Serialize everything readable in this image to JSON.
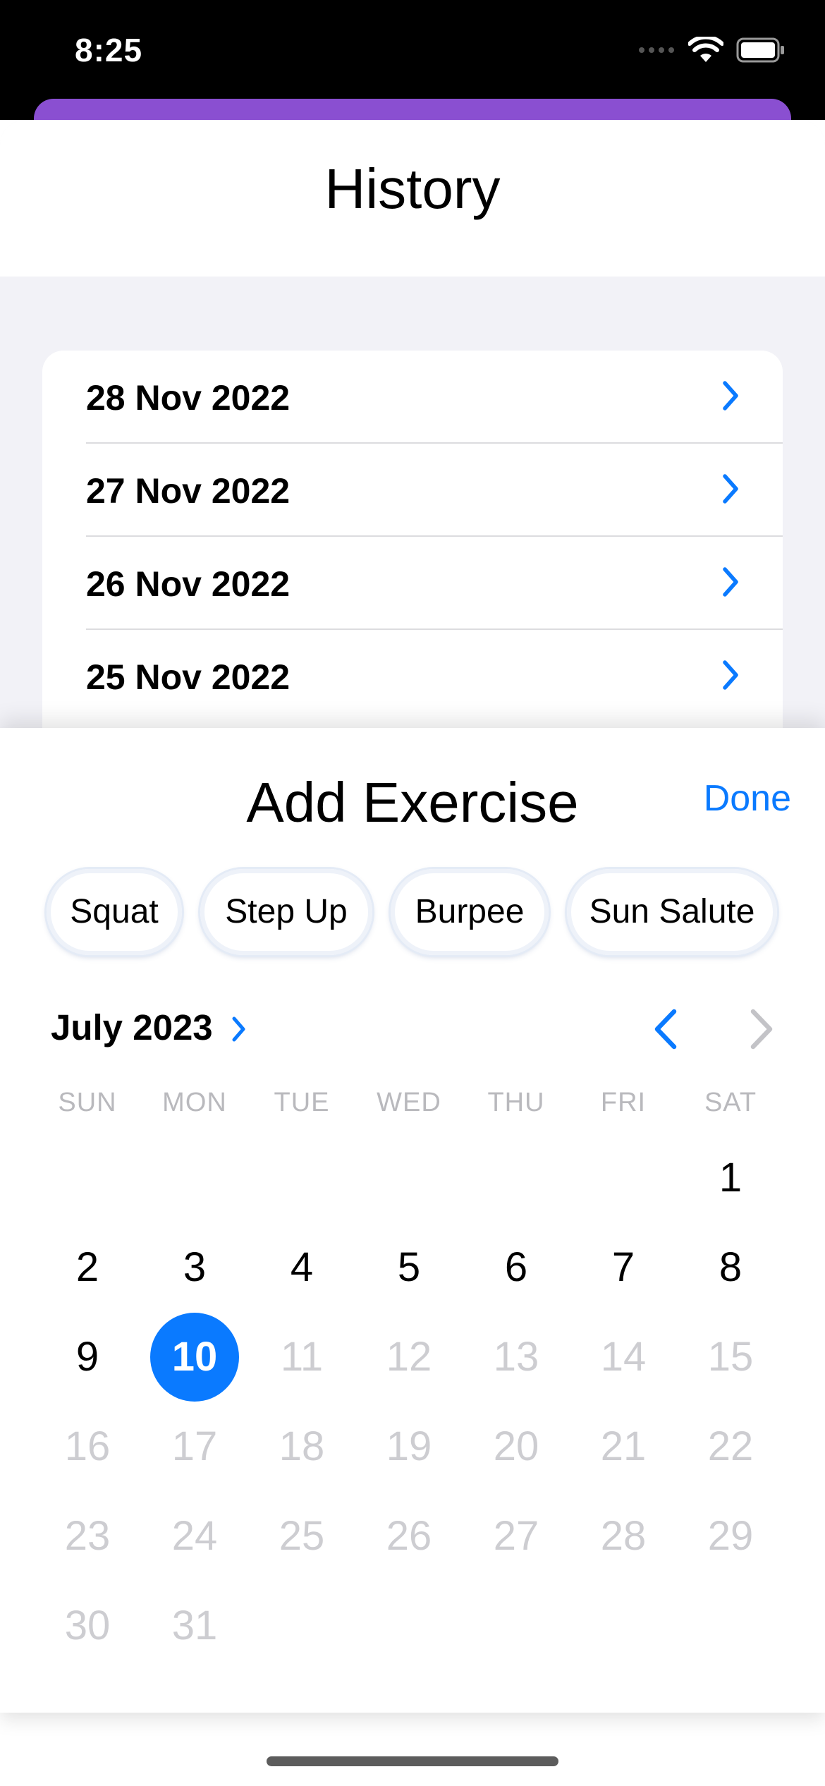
{
  "status_bar": {
    "time": "8:25"
  },
  "history": {
    "title": "History",
    "items": [
      {
        "date": "28 Nov 2022"
      },
      {
        "date": "27 Nov 2022"
      },
      {
        "date": "26 Nov 2022"
      },
      {
        "date": "25 Nov 2022"
      }
    ]
  },
  "add_exercise": {
    "title": "Add Exercise",
    "done_label": "Done",
    "chips": [
      "Squat",
      "Step Up",
      "Burpee",
      "Sun Salute"
    ],
    "calendar": {
      "month_label": "July 2023",
      "weekdays": [
        "SUN",
        "MON",
        "TUE",
        "WED",
        "THU",
        "FRI",
        "SAT"
      ],
      "days": [
        "1",
        "2",
        "3",
        "4",
        "5",
        "6",
        "7",
        "8",
        "9",
        "10",
        "11",
        "12",
        "13",
        "14",
        "15",
        "16",
        "17",
        "18",
        "19",
        "20",
        "21",
        "22",
        "23",
        "24",
        "25",
        "26",
        "27",
        "28",
        "29",
        "30",
        "31"
      ],
      "selected_day": "10",
      "enabled_through_day": 10
    }
  },
  "colors": {
    "accent": "#0a7aff",
    "purple": "#8a4fd1",
    "disabled_text": "#cdcdd1"
  }
}
